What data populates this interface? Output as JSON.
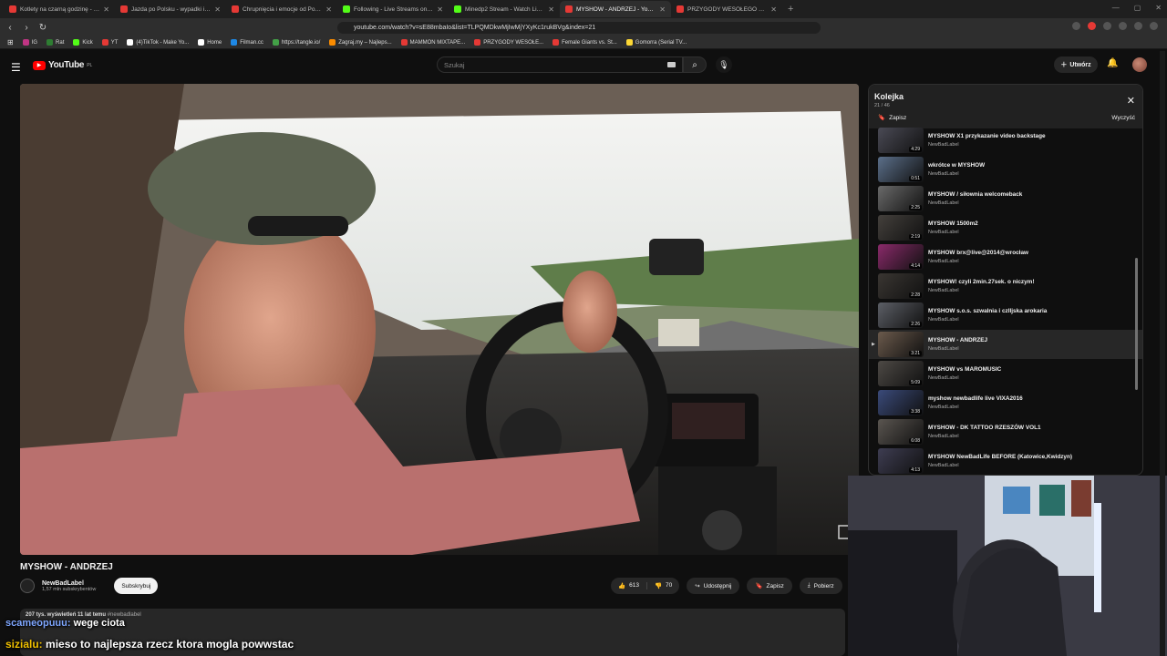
{
  "browser": {
    "tabs": [
      {
        "label": "Kotlety na czarną godzinę - mogą st",
        "color": "#e53935"
      },
      {
        "label": "Jazda po Polsku - wypadki i kolizje",
        "color": "#e53935"
      },
      {
        "label": "Chrupnięcia i emocje od Polny",
        "color": "#e53935"
      },
      {
        "label": "Following - Live Streams on Kick",
        "color": "#53fc18"
      },
      {
        "label": "Minedp2 Stream - Watch Live on Ki",
        "color": "#53fc18"
      },
      {
        "label": "MYSHOW - ANDRZEJ - YouTube",
        "color": "#e53935",
        "active": true
      },
      {
        "label": "PRZYGODY WESOŁEGO MAZURA wi",
        "color": "#e53935"
      }
    ],
    "new_tab": "+",
    "url": "youtube.com/watch?v=sE88mbaIo&list=TLPQMDkwMjIwMjYXyKc1rukBVg&index=21",
    "bookmarks": [
      {
        "label": "IG",
        "color": "#c13584"
      },
      {
        "label": "Rat",
        "color": "#2e7d32"
      },
      {
        "label": "Kick",
        "color": "#53fc18"
      },
      {
        "label": "YT",
        "color": "#e53935"
      },
      {
        "label": "(4)TikTok - Make Yo...",
        "color": "#ffffff"
      },
      {
        "label": "Home",
        "color": "#ffffff"
      },
      {
        "label": "Filman.cc",
        "color": "#1e88e5"
      },
      {
        "label": "https://tangle.io/",
        "color": "#43a047"
      },
      {
        "label": "Zagraj.my – Najleps...",
        "color": "#fb8c00"
      },
      {
        "label": "MAMMON MIXTAPE...",
        "color": "#e53935"
      },
      {
        "label": "PRZYGODY WESOŁE...",
        "color": "#e53935"
      },
      {
        "label": "Female Giants vs. St...",
        "color": "#e53935"
      },
      {
        "label": "Gomorra (Serial TV...",
        "color": "#fdd835"
      }
    ]
  },
  "youtube": {
    "logo_text": "YouTube",
    "logo_region": "PL",
    "search_placeholder": "Szukaj",
    "create_label": "Utwórz"
  },
  "video": {
    "title": "MYSHOW - ANDRZEJ",
    "channel": "NewBadLabel",
    "subscribers": "1,57 mln subskrybentów",
    "subscribe_label": "Subskrybuj",
    "likes": "613",
    "dislikes": "70",
    "share_label": "Udostępnij",
    "save_label": "Zapisz",
    "download_label": "Pobierz",
    "views": "207 tys. wyświetleń  11 lat temu",
    "hashtag": "#newbadlabel"
  },
  "queue": {
    "title": "Kolejka",
    "count": "21 / 46",
    "save_label": "Zapisz",
    "clear_label": "Wyczyść",
    "items": [
      {
        "title": "MYSHOW X1 przykazanie video backstage",
        "channel": "NewBadLabel",
        "duration": "4:29",
        "tint": "#4a4a55"
      },
      {
        "title": "wkrótce w MYSHOW",
        "channel": "NewBadLabel",
        "duration": "0:51",
        "tint": "#5b6f8a"
      },
      {
        "title": "MYSHOW / siłownia welcomeback",
        "channel": "NewBadLabel",
        "duration": "2:25",
        "tint": "#6a6a6a"
      },
      {
        "title": "MYSHOW 1500m2",
        "channel": "NewBadLabel",
        "duration": "2:19",
        "tint": "#44403c"
      },
      {
        "title": "MYSHOW brx@live@2014@wrocław",
        "channel": "NewBadLabel",
        "duration": "4:14",
        "tint": "#8a2a6a"
      },
      {
        "title": "MYSHOW! czyli 2min.27sek. o niczym!",
        "channel": "NewBadLabel",
        "duration": "2:28",
        "tint": "#3a3632"
      },
      {
        "title": "MYSHOW s.o.s. szwalnia i czlljska arokaria",
        "channel": "NewBadLabel",
        "duration": "2:26",
        "tint": "#5c5f66"
      },
      {
        "title": "MYSHOW - ANDRZEJ",
        "channel": "NewBadLabel",
        "duration": "3:21",
        "tint": "#6b5a4c",
        "active": true
      },
      {
        "title": "MYSHOW vs MAROMUSIC",
        "channel": "NewBadLabel",
        "duration": "5:09",
        "tint": "#4d4945"
      },
      {
        "title": "myshow newbadlife live VIXA2016",
        "channel": "NewBadLabel",
        "duration": "3:38",
        "tint": "#3a4a7a"
      },
      {
        "title": "MYSHOW - DK TATTOO RZESZÓW VOL1",
        "channel": "NewBadLabel",
        "duration": "6:08",
        "tint": "#5a5550"
      },
      {
        "title": "MYSHOW NewBadLife BEFORE (Katowice,Kwidzyn)",
        "channel": "NewBadLabel",
        "duration": "4:13",
        "tint": "#3e3d52"
      }
    ]
  },
  "overlay_chat": [
    {
      "user": "scameopuuu:",
      "message": "wege ciota"
    },
    {
      "user": "sizialu:",
      "message": "mieso to najlepsza rzecz ktora mogla powwstac"
    }
  ]
}
